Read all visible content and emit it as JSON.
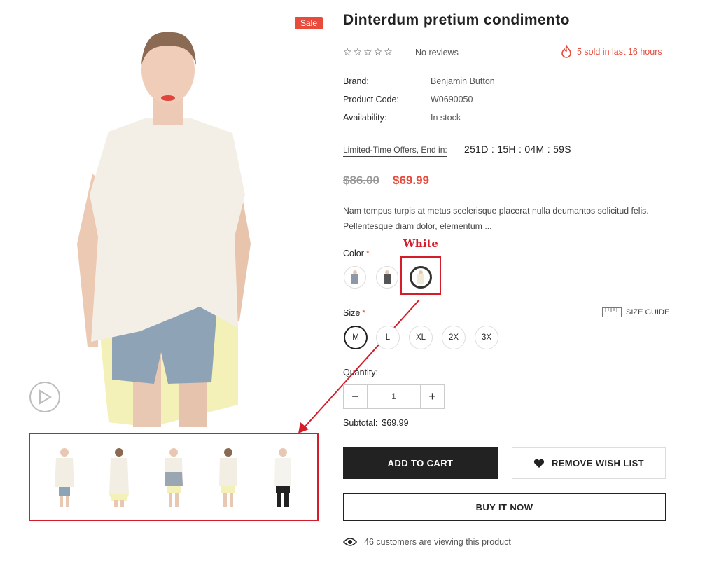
{
  "product": {
    "sale_badge": "Sale",
    "title": "Dinterdum pretium condimento",
    "stars": "☆☆☆☆☆",
    "reviews": "No reviews",
    "sold_text": "5 sold in last 16 hours",
    "specs": {
      "brand_label": "Brand:",
      "brand_value": "Benjamin Button",
      "code_label": "Product Code:",
      "code_value": "W0690050",
      "availability_label": "Availability:",
      "availability_value": "In stock"
    },
    "offer_label": "Limited-Time Offers, End in:",
    "countdown": "251D : 15H : 04M : 59S",
    "old_price": "$86.00",
    "new_price": "$69.99",
    "description": "Nam tempus turpis at metus scelerisque placerat nulla deumantos solicitud felis. Pellentesque diam dolor, elementum ..."
  },
  "options": {
    "color_label": "Color",
    "required_mark": "*",
    "color_annotation": "White",
    "size_label": "Size",
    "size_guide": "SIZE GUIDE",
    "sizes": [
      "M",
      "L",
      "XL",
      "2X",
      "3X"
    ],
    "selected_size": "M",
    "selected_color": "White"
  },
  "quantity": {
    "label": "Quantity:",
    "minus": "−",
    "plus": "+",
    "value": "1"
  },
  "subtotal": {
    "label": "Subtotal:",
    "value": "$69.99"
  },
  "actions": {
    "add_to_cart": "ADD TO CART",
    "wishlist": "REMOVE WISH LIST",
    "buy_now": "BUY IT NOW"
  },
  "viewing": "46 customers are viewing this product",
  "colors": {
    "accent": "#e84b3c",
    "annotation": "#d51d2a",
    "dark": "#222222"
  }
}
